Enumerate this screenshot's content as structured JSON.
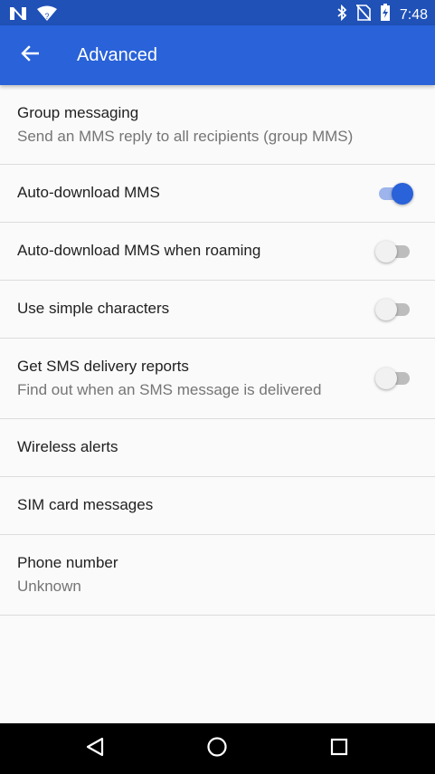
{
  "status_bar": {
    "time": "7:48",
    "icons_left": [
      "notification-n-icon",
      "wifi-question-icon"
    ],
    "icons_right": [
      "bluetooth-icon",
      "no-sim-icon",
      "battery-icon"
    ]
  },
  "app_bar": {
    "title": "Advanced",
    "back_icon": "arrow-back-icon",
    "background": "#2962d9"
  },
  "settings": {
    "group_messaging": {
      "title": "Group messaging",
      "summary": "Send an MMS reply to all recipients (group MMS)"
    },
    "auto_download_mms": {
      "title": "Auto-download MMS",
      "enabled": true
    },
    "auto_download_roaming": {
      "title": "Auto-download MMS when roaming",
      "enabled": false
    },
    "simple_characters": {
      "title": "Use simple characters",
      "enabled": false
    },
    "delivery_reports": {
      "title": "Get SMS delivery reports",
      "summary": "Find out when an SMS message is delivered",
      "enabled": false
    },
    "wireless_alerts": {
      "title": "Wireless alerts"
    },
    "sim_messages": {
      "title": "SIM card messages"
    },
    "phone_number": {
      "title": "Phone number",
      "summary": "Unknown"
    }
  },
  "nav_bar": {
    "icons": [
      "back-triangle-icon",
      "home-circle-icon",
      "recents-square-icon"
    ]
  },
  "colors": {
    "accent": "#2962d9",
    "status_bar": "#1f51b7"
  }
}
